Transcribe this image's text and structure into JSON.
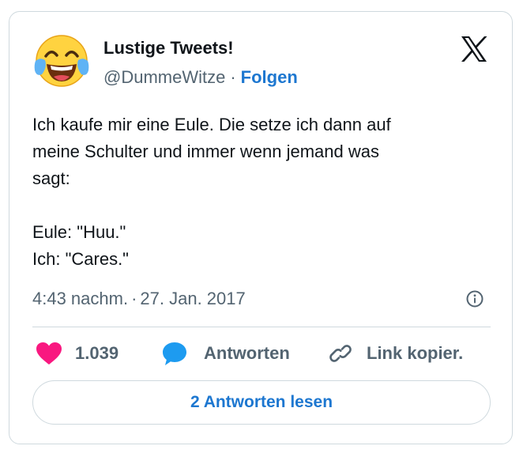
{
  "author": {
    "name": "Lustige Tweets!",
    "handle": "@DummeWitze",
    "separator": "·",
    "follow_label": "Folgen",
    "avatar_icon": "face-with-tears-of-joy-icon"
  },
  "brand_icon": "x-logo-icon",
  "tweet": {
    "lines": [
      "Ich kaufe mir eine Eule. Die setze ich dann auf",
      "meine Schulter und immer wenn jemand was",
      "sagt:",
      "",
      "Eule: \"Huu.\"",
      "Ich: \"Cares.\""
    ]
  },
  "meta": {
    "time": "4:43 nachm.",
    "separator": "·",
    "date": "27. Jan. 2017",
    "info_icon": "info-icon"
  },
  "actions": {
    "like_count": "1.039",
    "like_icon": "heart-icon",
    "reply_label": "Antworten",
    "reply_icon": "speech-bubble-icon",
    "copy_label": "Link kopier.",
    "copy_icon": "link-icon"
  },
  "read_replies_label": "2 Antworten lesen",
  "colors": {
    "accent": "#1d77d0",
    "like": "#f91880",
    "secondary_text": "#536471",
    "border": "#cfd9de"
  }
}
